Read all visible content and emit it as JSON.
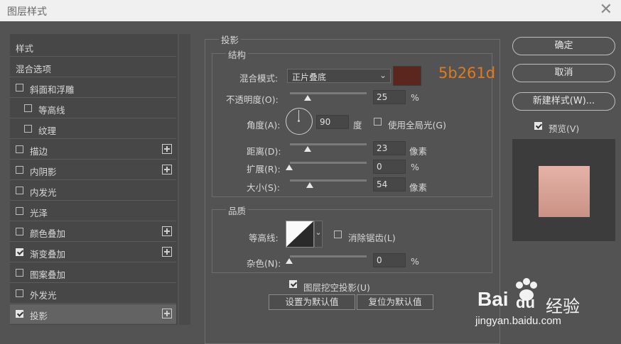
{
  "window": {
    "title": "图层样式"
  },
  "sidebar": {
    "items": [
      {
        "label": "样式"
      },
      {
        "label": "混合选项"
      },
      {
        "label": "斜面和浮雕"
      },
      {
        "label": "等高线"
      },
      {
        "label": "纹理"
      },
      {
        "label": "描边"
      },
      {
        "label": "内阴影"
      },
      {
        "label": "内发光"
      },
      {
        "label": "光泽"
      },
      {
        "label": "颜色叠加"
      },
      {
        "label": "渐变叠加"
      },
      {
        "label": "图案叠加"
      },
      {
        "label": "外发光"
      },
      {
        "label": "投影"
      }
    ]
  },
  "shadow": {
    "section_title": "投影",
    "structure_title": "结构",
    "blend_mode_label": "混合模式:",
    "blend_mode_value": "正片叠底",
    "color": "#5b261d",
    "color_hex_annotation": "5b261d",
    "opacity_label": "不透明度(O):",
    "opacity_value": "25",
    "opacity_unit": "%",
    "angle_label": "角度(A):",
    "angle_value": "90",
    "angle_unit": "度",
    "global_light_label": "使用全局光(G)",
    "distance_label": "距离(D):",
    "distance_value": "23",
    "distance_unit": "像素",
    "spread_label": "扩展(R):",
    "spread_value": "0",
    "spread_unit": "%",
    "size_label": "大小(S):",
    "size_value": "54",
    "size_unit": "像素",
    "quality_title": "品质",
    "contour_label": "等高线:",
    "antialias_label": "消除锯齿(L)",
    "noise_label": "杂色(N):",
    "noise_value": "0",
    "noise_unit": "%",
    "knockout_label": "图层挖空投影(U)",
    "set_default_label": "设置为默认值",
    "reset_default_label": "复位为默认值"
  },
  "actions": {
    "ok_label": "确定",
    "cancel_label": "取消",
    "new_style_label": "新建样式(W)...",
    "preview_label": "预览(V)"
  },
  "watermark": {
    "brand": "Bai",
    "brand2": "经验",
    "url": "jingyan.baidu.com"
  }
}
